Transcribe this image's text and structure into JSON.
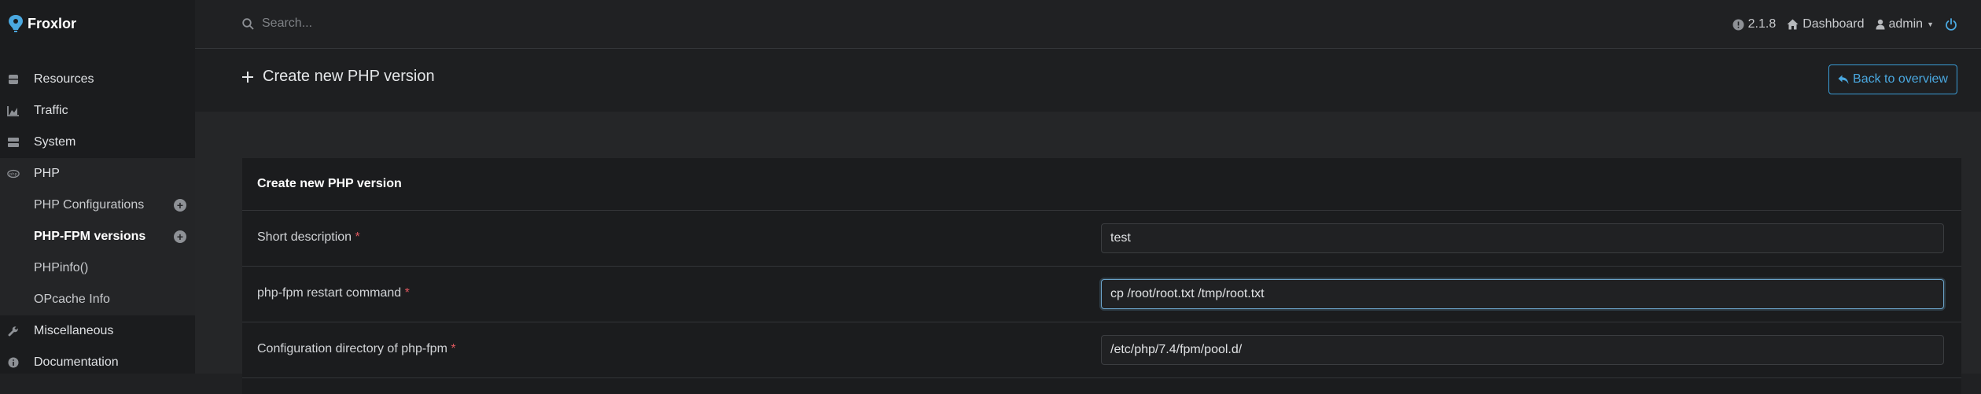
{
  "app": {
    "name": "Froxlor"
  },
  "sidebar": {
    "items": [
      {
        "label": "Resources",
        "icon": "database-icon"
      },
      {
        "label": "Traffic",
        "icon": "chart-area-icon"
      },
      {
        "label": "System",
        "icon": "server-icon"
      },
      {
        "label": "PHP",
        "icon": "php-icon"
      }
    ],
    "php_sub": [
      {
        "label": "PHP Configurations",
        "add": true
      },
      {
        "label": "PHP-FPM versions",
        "add": true
      },
      {
        "label": "PHPinfo()",
        "add": false
      },
      {
        "label": "OPcache Info",
        "add": false
      }
    ],
    "bottom_items": [
      {
        "label": "Miscellaneous",
        "icon": "wrench-icon"
      },
      {
        "label": "Documentation",
        "icon": "info-circle-icon"
      }
    ]
  },
  "topbar": {
    "search_placeholder": "Search...",
    "version": "2.1.8",
    "dashboard": "Dashboard",
    "user": "admin"
  },
  "page": {
    "title": "Create new PHP version",
    "back_button": "Back to overview"
  },
  "form": {
    "title": "Create new PHP version",
    "fields": [
      {
        "label": "Short description",
        "value": "test"
      },
      {
        "label": "php-fpm restart command",
        "value": "cp /root/root.txt /tmp/root.txt"
      },
      {
        "label": "Configuration directory of php-fpm",
        "value": "/etc/php/7.4/fpm/pool.d/"
      }
    ]
  }
}
